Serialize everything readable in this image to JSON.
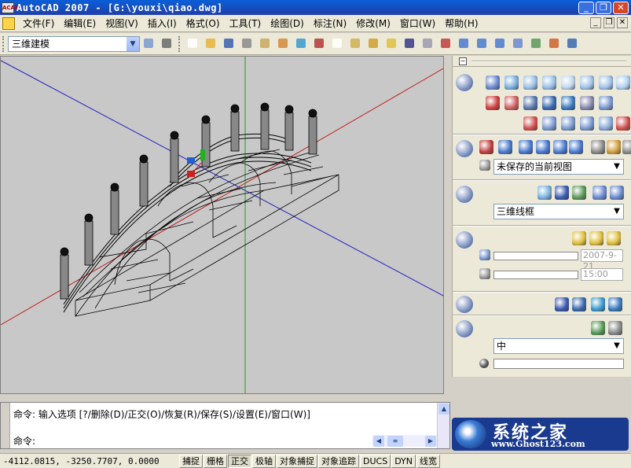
{
  "titlebar": {
    "title": "AutoCAD 2007 - [G:\\youxi\\qiao.dwg]",
    "icon_text": "ACAD"
  },
  "menubar": {
    "items": [
      "文件(F)",
      "编辑(E)",
      "视图(V)",
      "插入(I)",
      "格式(O)",
      "工具(T)",
      "绘图(D)",
      "标注(N)",
      "修改(M)",
      "窗口(W)",
      "帮助(H)"
    ]
  },
  "toolbar": {
    "workspace": "三维建模"
  },
  "panel": {
    "view_dropdown": "未保存的当前视图",
    "visual_style": "三维线框",
    "date_value": "2007-9-21",
    "time_value": "15:00",
    "material_dropdown": "中"
  },
  "command": {
    "history": "命令: 输入选项 [?/删除(D)/正交(O)/恢复(R)/保存(S)/设置(E)/窗口(W)]",
    "prompt": "命令:"
  },
  "status": {
    "coords": "-4112.0815, -3250.7707, 0.0000",
    "buttons": [
      {
        "label": "捕捉",
        "on": false
      },
      {
        "label": "栅格",
        "on": false
      },
      {
        "label": "正交",
        "on": true
      },
      {
        "label": "极轴",
        "on": false
      },
      {
        "label": "对象捕捉",
        "on": false
      },
      {
        "label": "对象追踪",
        "on": false
      },
      {
        "label": "DUCS",
        "on": false
      },
      {
        "label": "DYN",
        "on": false
      },
      {
        "label": "线宽",
        "on": false
      }
    ]
  },
  "watermark": {
    "text": "系统之家",
    "url": "www.Ghost123.com"
  },
  "colors": {
    "title_bg": "#1f4fc8",
    "viewport_bg": "#c8c8c8",
    "axis_x": "#c02020",
    "axis_y": "#2020c0",
    "axis_z": "#20a020"
  }
}
